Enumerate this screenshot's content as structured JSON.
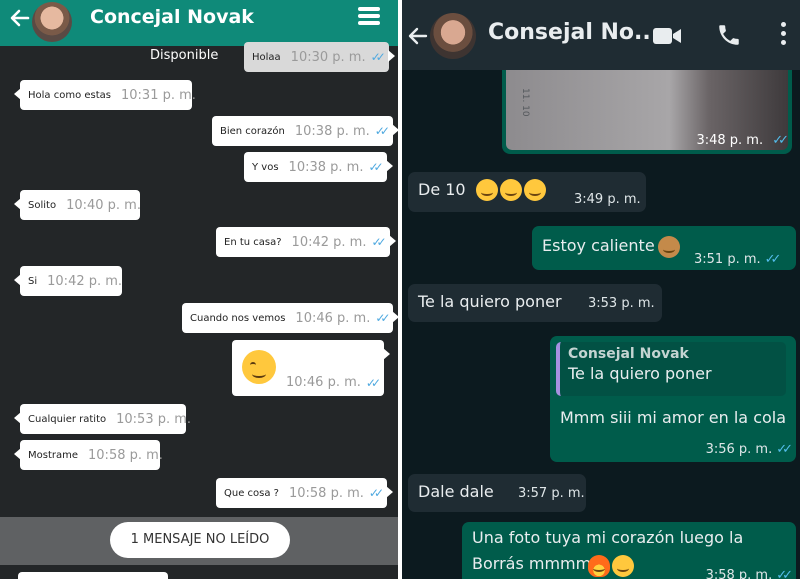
{
  "left": {
    "header": {
      "title": "Concejal Novak"
    },
    "status": "Disponible",
    "messages": [
      {
        "dir": "out",
        "text": "Holaa",
        "time": "10:30 p. m.",
        "ticks": "✓✓"
      },
      {
        "dir": "in",
        "text": "Hola como estas",
        "time": "10:31 p. m."
      },
      {
        "dir": "out",
        "text": "Bien corazón",
        "time": "10:38 p. m.",
        "ticks": "✓✓"
      },
      {
        "dir": "out",
        "text": "Y vos",
        "time": "10:38 p. m.",
        "ticks": "✓✓"
      },
      {
        "dir": "in",
        "text": "Solito",
        "time": "10:40 p. m."
      },
      {
        "dir": "out",
        "text": "En tu casa?",
        "time": "10:42 p. m.",
        "ticks": "✓✓"
      },
      {
        "dir": "in",
        "text": "Si",
        "time": "10:42 p. m."
      },
      {
        "dir": "out",
        "text": "Cuando nos vemos",
        "time": "10:46 p. m.",
        "ticks": "✓✓"
      },
      {
        "dir": "out",
        "emoji": "winking-face",
        "time": "10:46 p. m.",
        "ticks": "✓✓"
      },
      {
        "dir": "in",
        "text": "Cualquier ratito",
        "time": "10:53 p. m."
      },
      {
        "dir": "in",
        "text": "Mostrame",
        "time": "10:58 p. m."
      },
      {
        "dir": "out",
        "text": "Que cosa ?",
        "time": "10:58 p. m.",
        "ticks": "✓✓"
      }
    ],
    "unread_label": "1 MENSAJE NO LEÍDO",
    "accent": "#0f8a79"
  },
  "right": {
    "header": {
      "title": "Consejal No..."
    },
    "photo_message": {
      "time": "3:48 p. m.",
      "ticks": "✓✓",
      "photo_text": "11. 10"
    },
    "messages": [
      {
        "dir": "in",
        "text": "De 10",
        "emoji": "grinning-face x3",
        "time": "3:49 p. m."
      },
      {
        "dir": "out",
        "text": "Estoy caliente",
        "emoji": "see-no-evil-monkey",
        "time": "3:51 p. m.",
        "ticks": "✓✓"
      },
      {
        "dir": "in",
        "text": "Te la quiero poner",
        "time": "3:53 p. m."
      },
      {
        "dir": "out",
        "quote": {
          "author": "Consejal Novak",
          "text": "Te la quiero poner"
        },
        "text": "Mmm siii mi amor en la cola",
        "time": "3:56 p. m.",
        "ticks": "✓✓"
      },
      {
        "dir": "in",
        "text": "Dale dale",
        "time": "3:57 p. m."
      },
      {
        "dir": "out",
        "text_line1": "Una foto tuya mi corazón luego la",
        "text_line2": "Borrás mmmm",
        "emoji": "fire, drooling-face",
        "time": "3:58 p. m.",
        "ticks": "✓✓"
      }
    ],
    "incoming_color": "#1f2c33",
    "outgoing_color": "#005c4b",
    "tick_color": "#53bdeb"
  }
}
